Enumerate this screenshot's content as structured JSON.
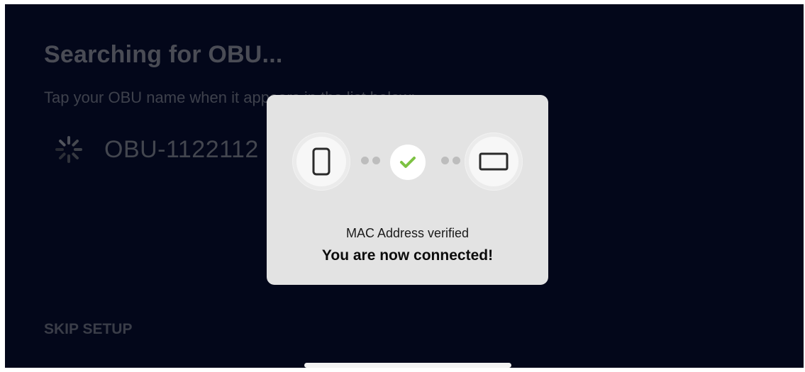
{
  "header": {
    "title": "Searching for OBU...",
    "subtitle": "Tap your OBU name when it appears in the list below:"
  },
  "device_list": {
    "items": [
      {
        "name": "OBU-1122112",
        "icon": "loading-spinner-icon"
      }
    ]
  },
  "footer": {
    "skip_label": "SKIP SETUP"
  },
  "dialog": {
    "status_text": "MAC Address verified",
    "message": "You are now connected!",
    "icons": [
      "phone-icon",
      "connection-dots-icon",
      "checkmark-icon",
      "tablet-icon"
    ]
  },
  "colors": {
    "background": "#03071a",
    "dialog_background": "#e3e3e3",
    "check_green": "#7dc243",
    "dimmed_text": "#4a4c55"
  }
}
